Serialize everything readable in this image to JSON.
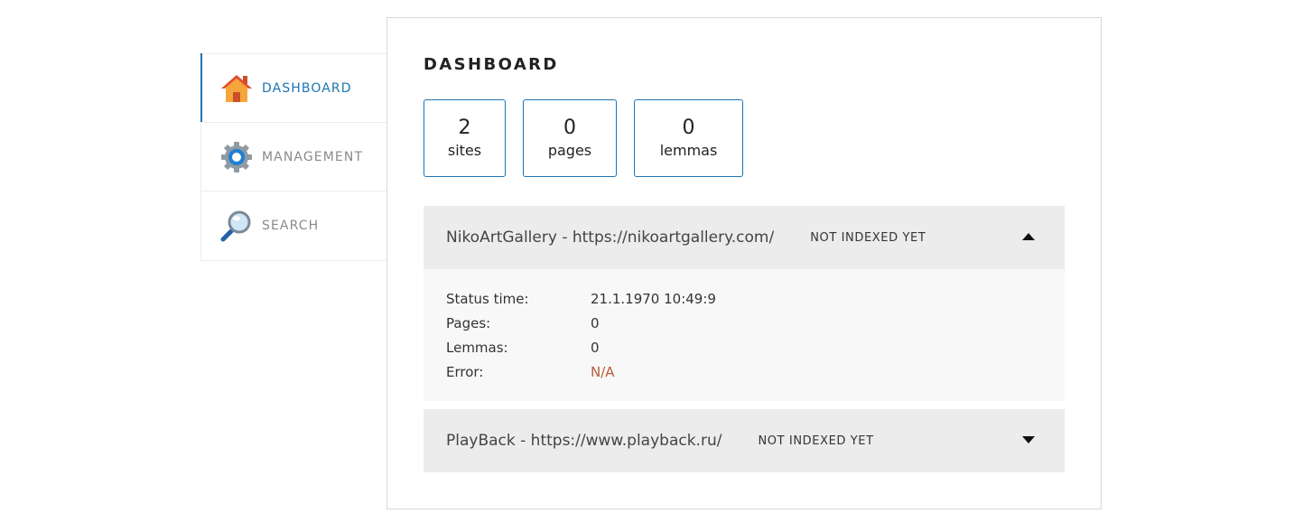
{
  "nav": {
    "items": [
      {
        "label": "DASHBOARD",
        "icon": "house-icon",
        "active": true
      },
      {
        "label": "MANAGEMENT",
        "icon": "gear-icon",
        "active": false
      },
      {
        "label": "SEARCH",
        "icon": "magnifier-icon",
        "active": false
      }
    ]
  },
  "main": {
    "title": "DASHBOARD",
    "stats": [
      {
        "value": "2",
        "label": "sites"
      },
      {
        "value": "0",
        "label": "pages"
      },
      {
        "value": "0",
        "label": "lemmas"
      }
    ],
    "sites": [
      {
        "name": "NikoArtGallery - https://nikoartgallery.com/",
        "status": "NOT INDEXED YET",
        "expanded": true,
        "details": {
          "status_time_label": "Status time:",
          "status_time": "21.1.1970 10:49:9",
          "pages_label": "Pages:",
          "pages": "0",
          "lemmas_label": "Lemmas:",
          "lemmas": "0",
          "error_label": "Error:",
          "error": "N/A"
        }
      },
      {
        "name": "PlayBack - https://www.playback.ru/",
        "status": "NOT INDEXED YET",
        "expanded": false
      }
    ]
  },
  "colors": {
    "accent": "#1c75b5",
    "error": "#b85a3a",
    "site_header_bg": "#ececec",
    "site_body_bg": "#f8f8f8"
  }
}
